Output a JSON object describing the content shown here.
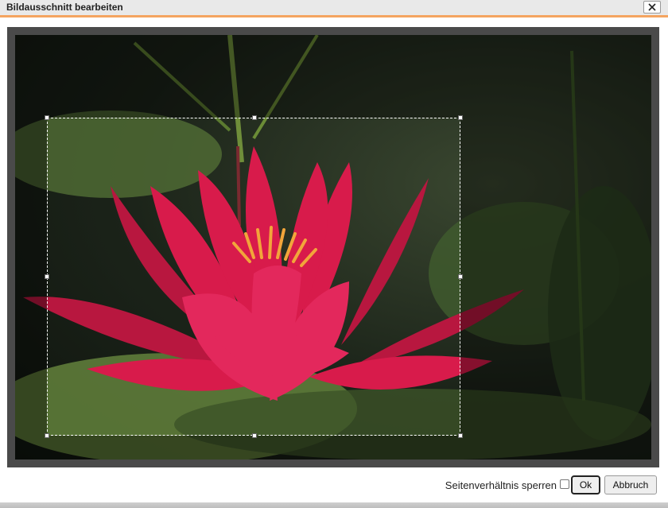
{
  "dialog": {
    "title": "Bildausschnitt bearbeiten"
  },
  "icons": {
    "close": "close-icon"
  },
  "footer": {
    "ratio_label": "Seitenverhältnis sperren",
    "ratio_checked": false,
    "ok_label": "Ok",
    "cancel_label": "Abbruch"
  },
  "colors": {
    "title_accent": "#f4a460",
    "petal": "#d81b4b",
    "stamen": "#f2a53a",
    "lily_pad": "#5e7c3a"
  }
}
